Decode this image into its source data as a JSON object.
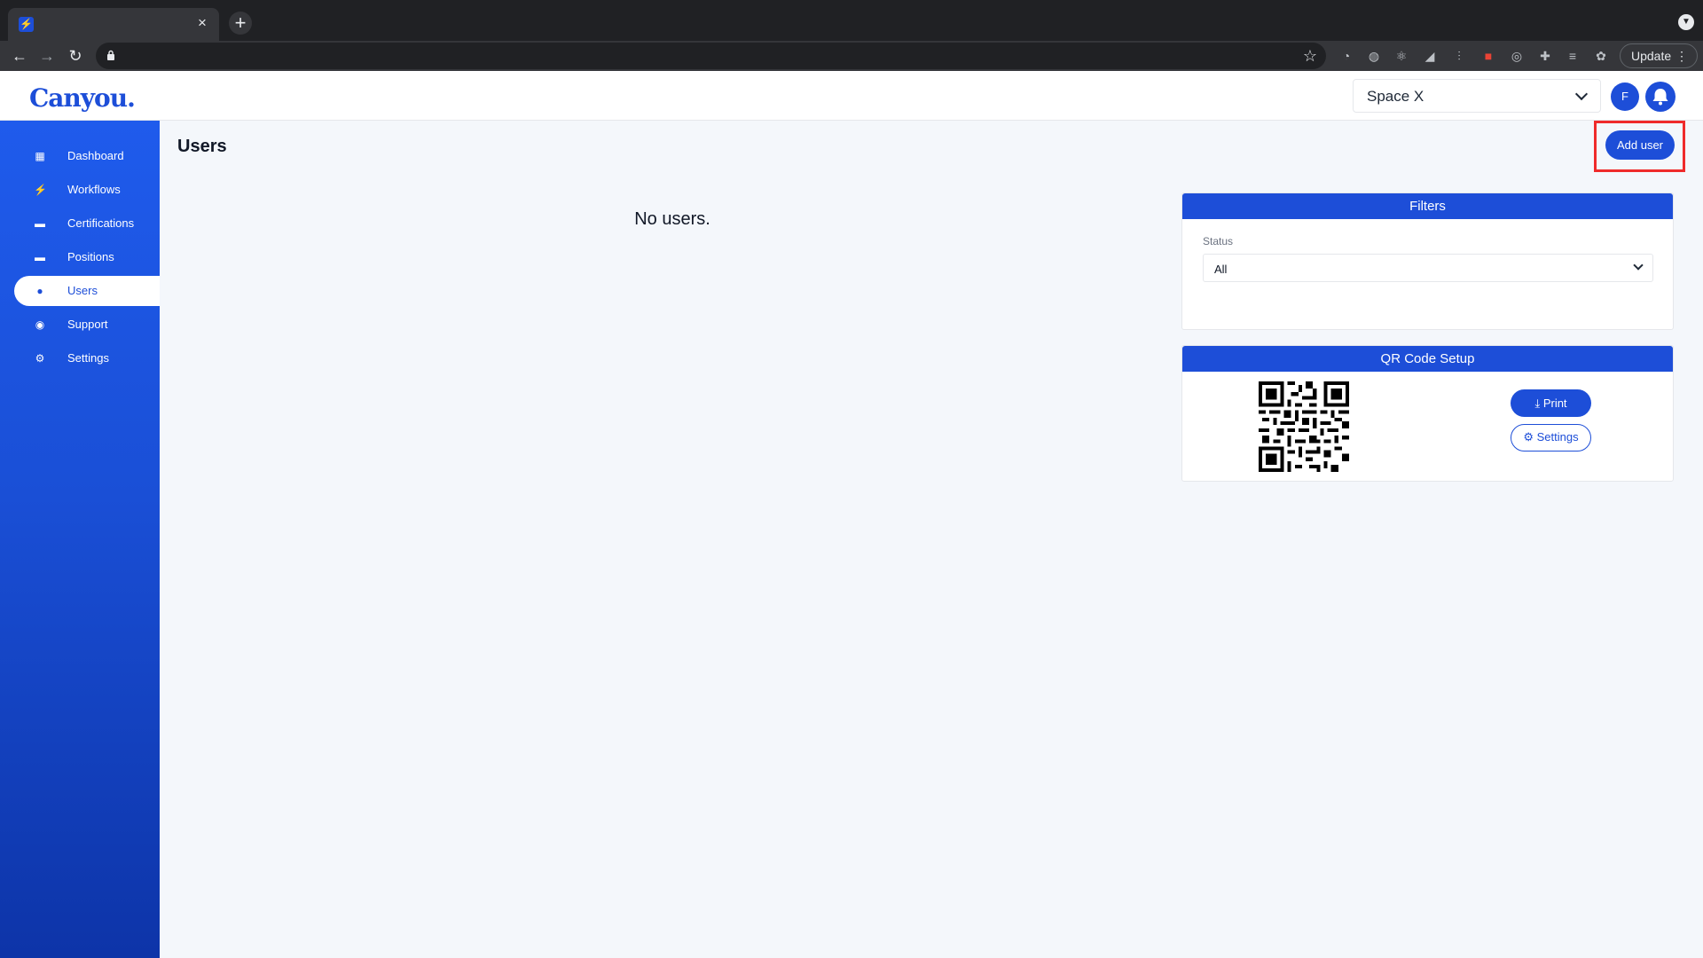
{
  "browser": {
    "tab_close": "×",
    "new_tab": "+",
    "update_label": "Update",
    "update_menu": "⋮"
  },
  "header": {
    "logo": "Canyou.",
    "workspace": "Space X",
    "avatar_initial": "F"
  },
  "sidebar": {
    "items": [
      {
        "label": "Dashboard",
        "icon": "dashboard-icon",
        "glyph": "▦"
      },
      {
        "label": "Workflows",
        "icon": "bolt-icon",
        "glyph": "⚡"
      },
      {
        "label": "Certifications",
        "icon": "briefcase-icon",
        "glyph": "▬"
      },
      {
        "label": "Positions",
        "icon": "briefcase-icon",
        "glyph": "▬"
      },
      {
        "label": "Users",
        "icon": "user-icon",
        "glyph": "●"
      },
      {
        "label": "Support",
        "icon": "chat-icon",
        "glyph": "◉"
      },
      {
        "label": "Settings",
        "icon": "gear-icon",
        "glyph": "⚙"
      }
    ],
    "active_index": 4
  },
  "main": {
    "title": "Users",
    "add_user_label": "Add user",
    "empty_message": "No users."
  },
  "filters": {
    "title": "Filters",
    "status_label": "Status",
    "status_value": "All"
  },
  "qr_setup": {
    "title": "QR Code Setup",
    "print_label": "Print",
    "settings_label": "Settings"
  },
  "colors": {
    "brand": "#1d4ed8",
    "highlight": "#ef2b2b"
  }
}
